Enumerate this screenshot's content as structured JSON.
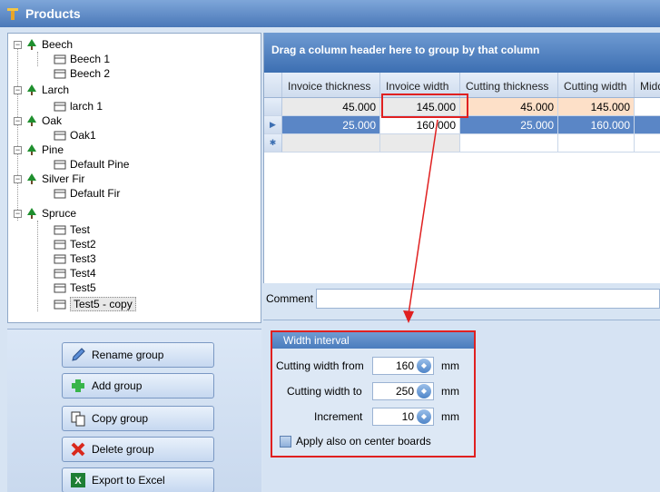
{
  "window": {
    "title": "Products"
  },
  "tree": {
    "groups": [
      {
        "label": "Beech",
        "items": [
          "Beech 1",
          "Beech 2"
        ]
      },
      {
        "label": "Larch",
        "items": [
          "larch 1"
        ]
      },
      {
        "label": "Oak",
        "items": [
          "Oak1"
        ]
      },
      {
        "label": "Pine",
        "items": [
          "Default Pine"
        ]
      },
      {
        "label": "Silver Fir",
        "items": [
          "Default Fir"
        ]
      },
      {
        "label": "Spruce",
        "items": [
          "Test",
          "Test2",
          "Test3",
          "Test4",
          "Test5",
          "Test5 - copy"
        ]
      }
    ],
    "selected": "Test5 - copy"
  },
  "buttons": {
    "rename": "Rename group",
    "add": "Add group",
    "copy": "Copy group",
    "delete": "Delete group",
    "export": "Export to Excel"
  },
  "grid": {
    "group_hint": "Drag a column header here to group by that column",
    "columns": [
      "Invoice thickness",
      "Invoice width",
      "Cutting thickness",
      "Cutting width",
      "Midd"
    ],
    "rows": [
      [
        "45.000",
        "145.000",
        "45.000",
        "145.000",
        ""
      ],
      [
        "25.000",
        "160.000",
        "25.000",
        "160.000",
        ""
      ]
    ]
  },
  "comment": {
    "label": "Comment",
    "value": ""
  },
  "width_interval": {
    "title": "Width interval",
    "from_label": "Cutting width from",
    "from_value": "160",
    "to_label": "Cutting width to",
    "to_value": "250",
    "inc_label": "Increment",
    "inc_value": "10",
    "unit": "mm",
    "apply_label": "Apply also on center boards"
  },
  "colors": {
    "accent": "#3c6fb2",
    "highlight": "#e02020",
    "row_orange": "#fde0c8"
  }
}
